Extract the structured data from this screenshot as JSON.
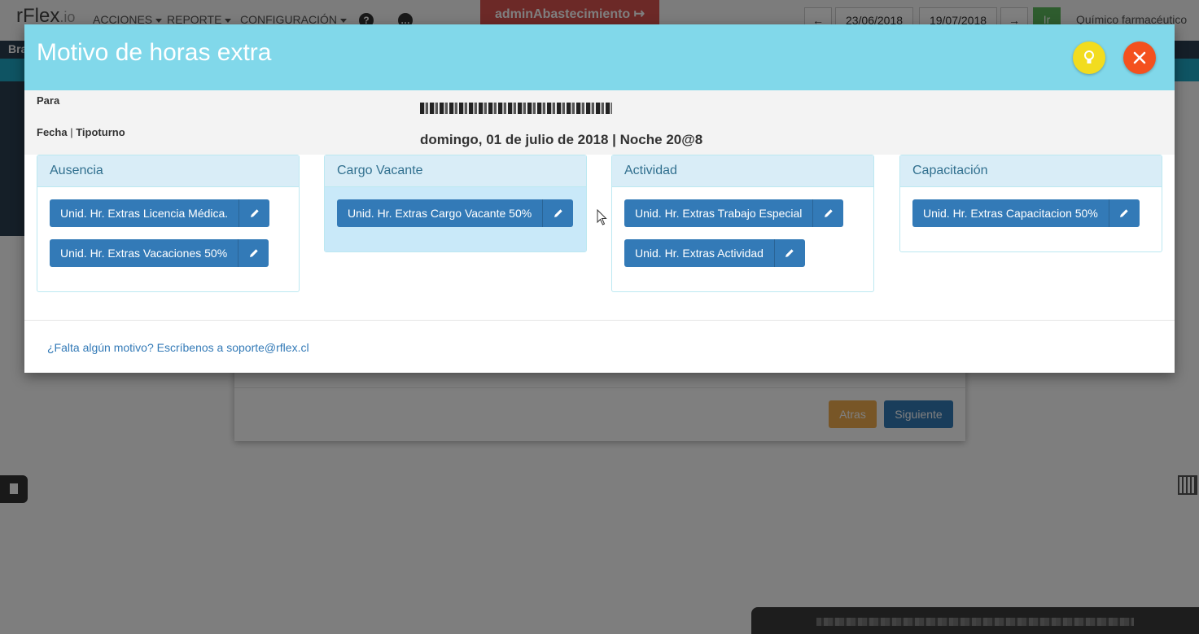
{
  "app": {
    "brand": "rFlex",
    "brand_tld": ".io",
    "menu": [
      "ACCIONES",
      "REPORTE",
      "CONFIGURACIÓN"
    ],
    "user_button": "adminAbastecimiento",
    "date_from": "23/06/2018",
    "date_to": "19/07/2018",
    "go_label": "Ir",
    "role": "Químico farmacéutico",
    "subbar_text": "Bra",
    "wizard_back": "Atras",
    "wizard_next": "Siguiente"
  },
  "modal": {
    "title": "Motivo de horas extra",
    "para_label": "Para",
    "fecha_label": "Fecha",
    "separator": "|",
    "tipoturno_label": "Tipoturno",
    "fecha_value": "domingo, 01 de julio de 2018 | Noche 20@8",
    "panels": [
      {
        "heading": "Ausencia",
        "buttons": [
          "Unid. Hr. Extras Licencia Médica.",
          "Unid. Hr. Extras Vacaciones 50%"
        ]
      },
      {
        "heading": "Cargo Vacante",
        "buttons": [
          "Unid. Hr. Extras Cargo Vacante 50%"
        ]
      },
      {
        "heading": "Actividad",
        "buttons": [
          "Unid. Hr. Extras Trabajo Especial",
          "Unid. Hr. Extras Actividad"
        ]
      },
      {
        "heading": "Capacitación",
        "buttons": [
          "Unid. Hr. Extras Capacitacion 50%"
        ]
      }
    ],
    "support_text": "¿Falta algún motivo? Escríbenos a soporte@rflex.cl"
  },
  "colors": {
    "header": "#81d8ea",
    "primary": "#337ab7",
    "hint": "#f2dc1f",
    "close": "#f4511e",
    "panel_heading": "#d9edf7"
  },
  "icons": {
    "hint": "lightbulb-icon",
    "close": "close-icon",
    "edit": "pencil-icon"
  }
}
